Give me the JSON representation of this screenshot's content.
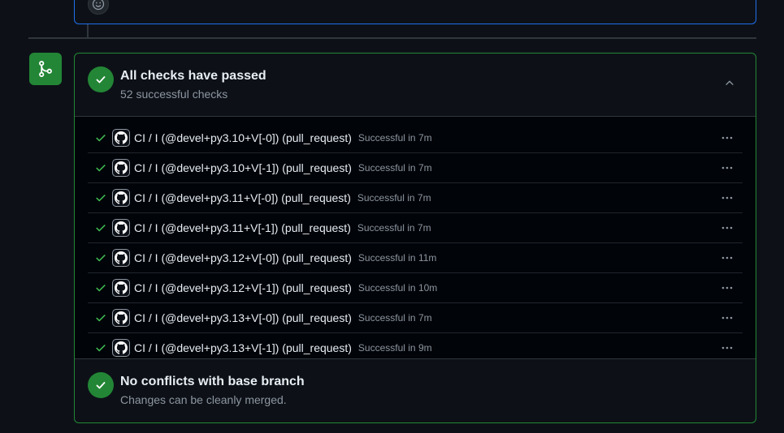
{
  "checks_summary": {
    "title": "All checks have passed",
    "subtitle": "52 successful checks"
  },
  "checks": [
    {
      "name": "CI / I (@devel+py3.10+V[-0]) (pull_request)",
      "status": "Successful in 7m"
    },
    {
      "name": "CI / I (@devel+py3.10+V[-1]) (pull_request)",
      "status": "Successful in 7m"
    },
    {
      "name": "CI / I (@devel+py3.11+V[-0]) (pull_request)",
      "status": "Successful in 7m"
    },
    {
      "name": "CI / I (@devel+py3.11+V[-1]) (pull_request)",
      "status": "Successful in 7m"
    },
    {
      "name": "CI / I (@devel+py3.12+V[-0]) (pull_request)",
      "status": "Successful in 11m"
    },
    {
      "name": "CI / I (@devel+py3.12+V[-1]) (pull_request)",
      "status": "Successful in 10m"
    },
    {
      "name": "CI / I (@devel+py3.13+V[-0]) (pull_request)",
      "status": "Successful in 7m"
    },
    {
      "name": "CI / I (@devel+py3.13+V[-1]) (pull_request)",
      "status": "Successful in 9m"
    }
  ],
  "merge_status": {
    "title": "No conflicts with base branch",
    "subtitle": "Changes can be cleanly merged."
  },
  "icons": {
    "merge_box": "git-branch-icon",
    "status": "check-circle-icon",
    "row_status": "check-icon",
    "row_avatar": "github-icon",
    "row_menu": "kebab-horizontal-icon",
    "collapse": "chevron-up-icon",
    "reaction": "smiley-icon"
  },
  "colors": {
    "success": "#238636",
    "success_text": "#3fb950",
    "accent_border": "#1f6feb",
    "muted": "#8d96a0"
  }
}
